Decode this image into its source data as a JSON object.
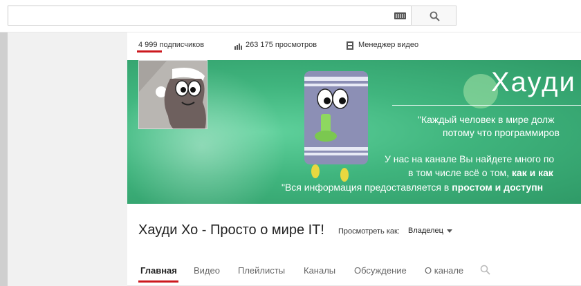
{
  "search": {
    "value": "",
    "placeholder": ""
  },
  "icons": {
    "keyboard": "keyboard-icon",
    "search": "search-icon",
    "views": "bar-chart-icon",
    "manager": "film-icon"
  },
  "stats": {
    "subscribers": "4 999 подписчиков",
    "views": "263 175 просмотров",
    "manager": "Менеджер видео"
  },
  "banner": {
    "title": "Хауди",
    "line1": "\"Каждый человек в мире долж",
    "line2": "потому что программиров",
    "line3": "У нас на канале Вы найдете много по",
    "line4_plain": "в том числе всё о том,",
    "line4_bold": "как и как",
    "line5_plain": "\"Вся информация предоставляется в",
    "line5_bold": "простом и доступн"
  },
  "channel": {
    "title": "Хауди Хо - Просто о мире IT!",
    "view_as_label": "Просмотреть как:",
    "view_as_value": "Владелец"
  },
  "tabs": [
    "Главная",
    "Видео",
    "Плейлисты",
    "Каналы",
    "Обсуждение",
    "О канале"
  ],
  "colors": {
    "accent": "#cc181e",
    "banner": "#40b57e"
  }
}
